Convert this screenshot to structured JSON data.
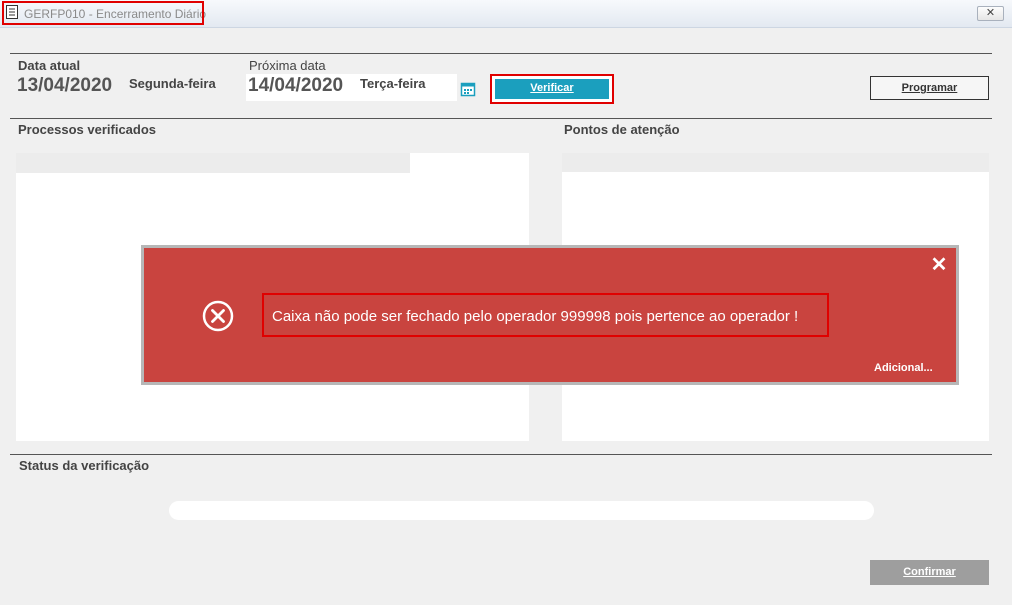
{
  "window": {
    "title": "GERFP010 - Encerramento Diário",
    "close_symbol": "✕"
  },
  "current_date": {
    "label": "Data atual",
    "value": "13/04/2020",
    "weekday": "Segunda-feira"
  },
  "next_date": {
    "label": "Próxima data",
    "value": "14/04/2020",
    "weekday": "Terça-feira"
  },
  "buttons": {
    "verify": "Verificar",
    "schedule": "Programar",
    "confirm": "Confirmar"
  },
  "panels": {
    "processes": "Processos verificados",
    "attention": "Pontos de atenção",
    "status": "Status da verificação"
  },
  "progress": {
    "value": 0
  },
  "dialog": {
    "message": "Caixa não pode ser fechado pelo operador 999998 pois pertence ao operador !",
    "more_link": "Adicional...",
    "close_symbol": "✕"
  },
  "icons": {
    "title": "document-icon",
    "calendar": "calendar-icon",
    "error": "error-x-icon"
  },
  "colors": {
    "accent": "#1b9fbe",
    "error": "#c9443f",
    "highlight": "#e00000",
    "disabled": "#9e9e9e"
  }
}
